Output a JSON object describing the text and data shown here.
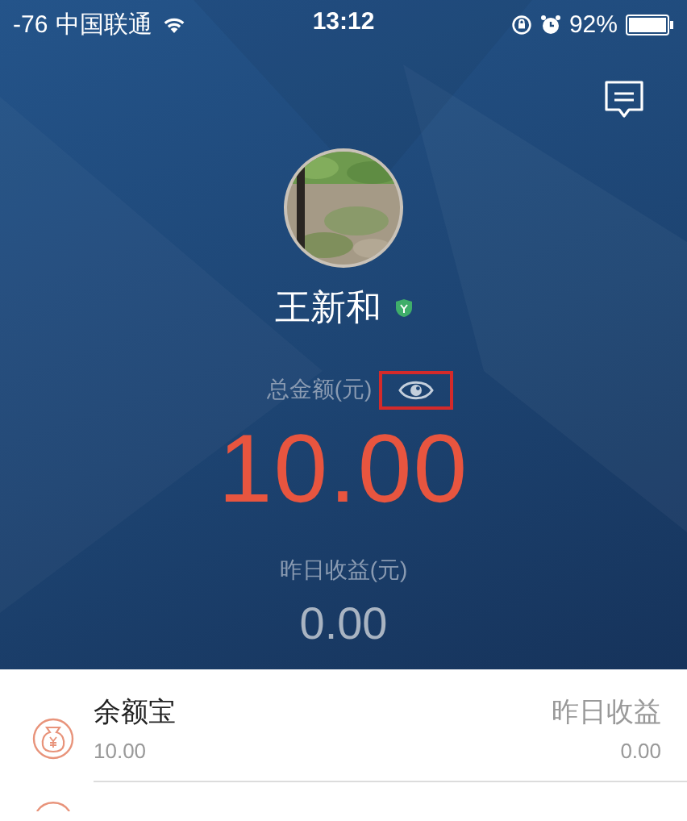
{
  "status_bar": {
    "signal": "-76",
    "carrier": "中国联通",
    "time": "13:12",
    "battery": "92%"
  },
  "profile": {
    "name": "王新和",
    "verified": true
  },
  "total": {
    "label": "总金额(元)",
    "amount": "10.00",
    "highlighted": true
  },
  "yesterday": {
    "label": "昨日收益(元)",
    "amount": "0.00"
  },
  "items": [
    {
      "title": "余额宝",
      "amount": "10.00",
      "side_label": "昨日收益",
      "side_value": "0.00"
    }
  ]
}
